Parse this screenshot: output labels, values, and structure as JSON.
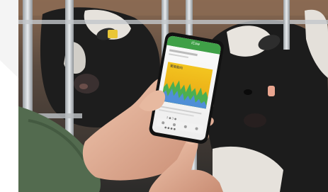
{
  "scene": {
    "subject": "hand holding smartphone with dairy monitoring app in a cow barn",
    "palette": {
      "barn_wall": "#7a5c46",
      "cow_black": "#1c1c1c",
      "cow_white": "#e6e2dc",
      "ear_tag": "#e9c637",
      "skin": "#e3b49b",
      "sleeve": "#536b4f",
      "app_green": "#3fa047",
      "chart_yellow": "#f0c419",
      "chart_green": "#4caf50",
      "chart_blue": "#4f8fd6"
    }
  },
  "phone": {
    "title": "iCow",
    "caption": "繁殖動向",
    "detail": "2 ● 3 ●",
    "nav": "● ● ● ●"
  }
}
